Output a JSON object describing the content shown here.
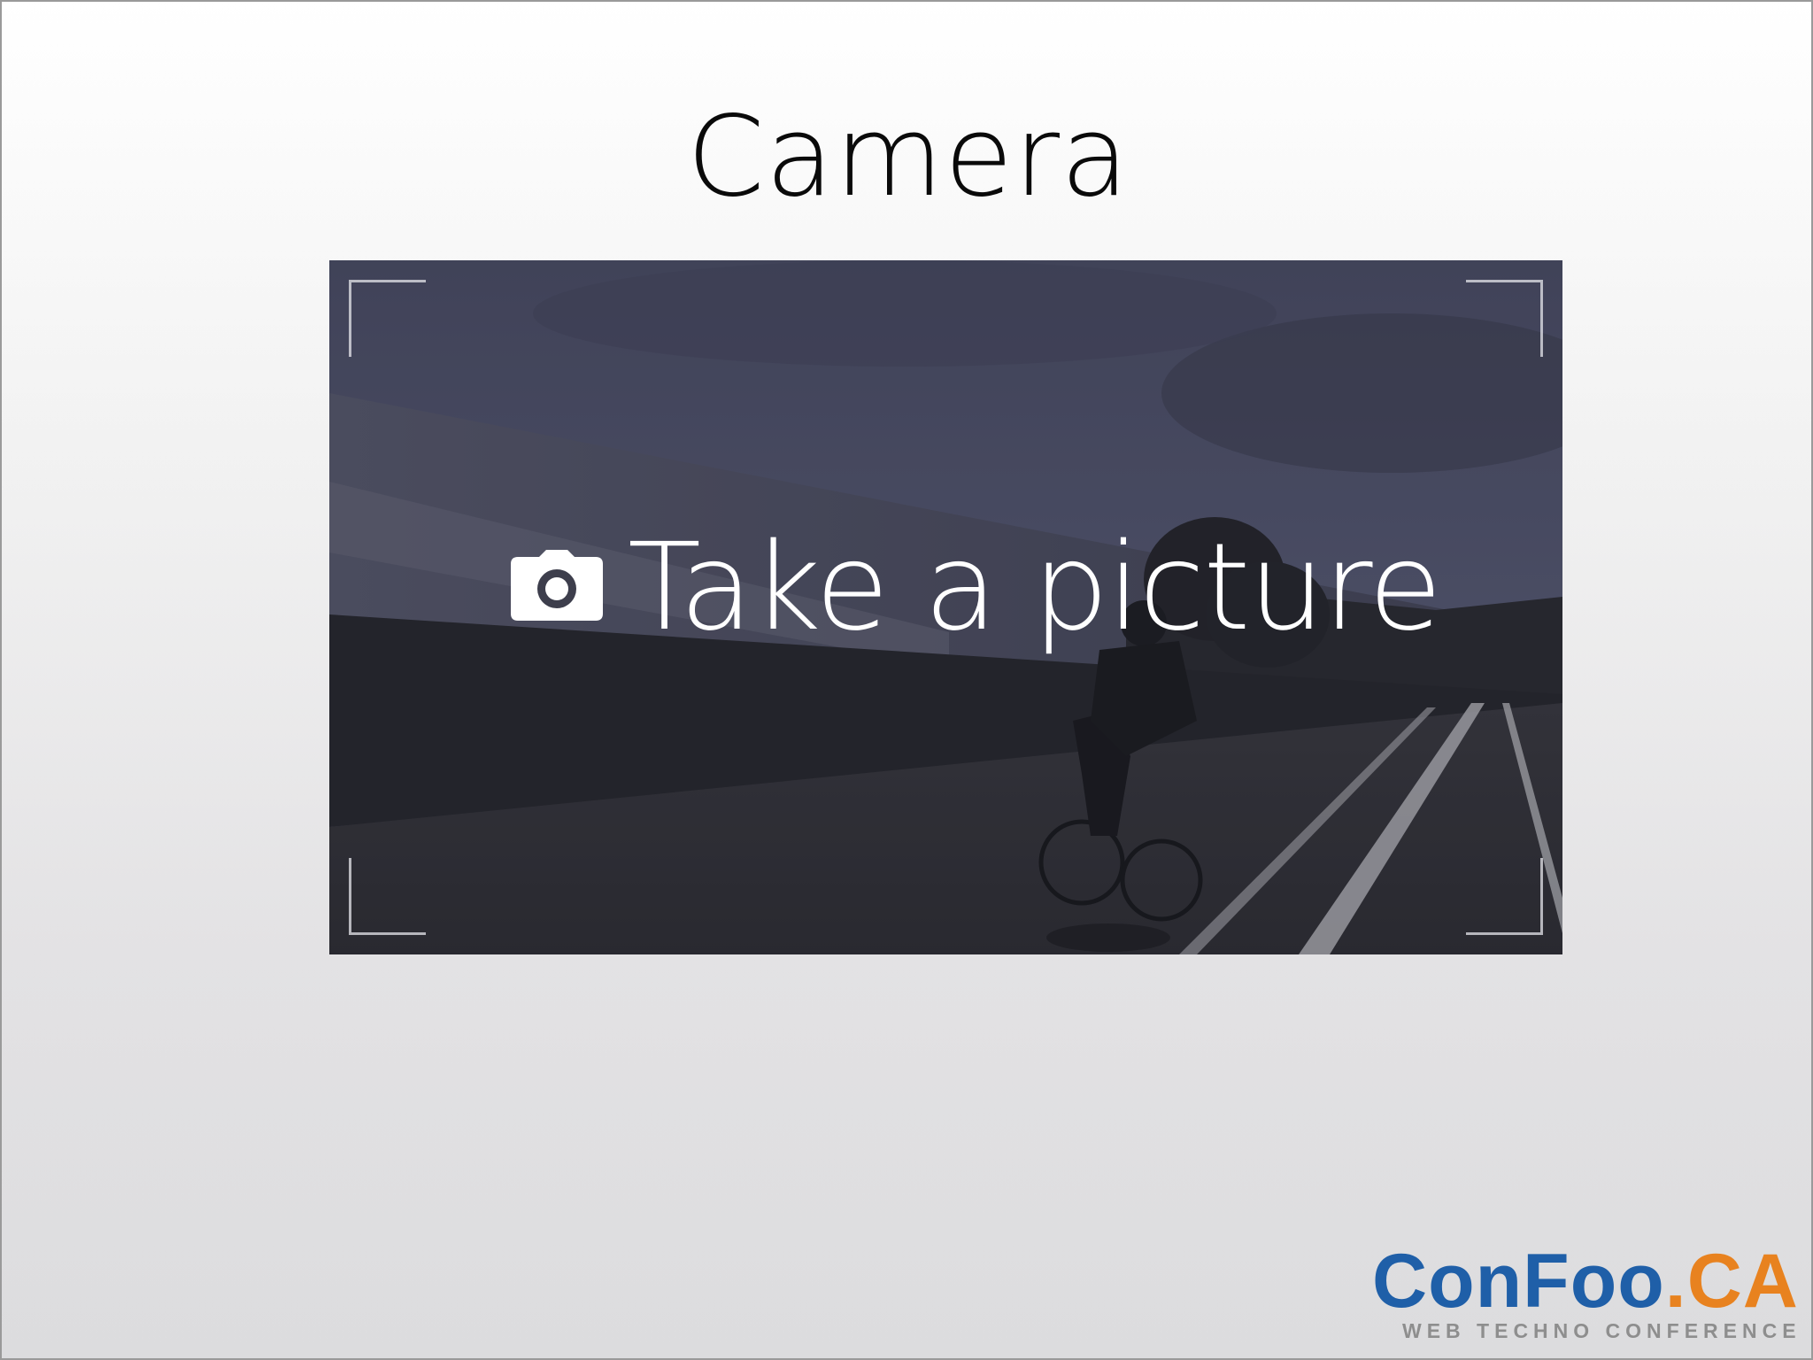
{
  "slide": {
    "title": "Camera"
  },
  "glass_card": {
    "label": "Take a picture",
    "icon": "camera-icon"
  },
  "logo": {
    "main": "ConFoo",
    "dot": ".",
    "tld": "CA",
    "tagline": "WEB TECHNO CONFERENCE"
  },
  "colors": {
    "logo_blue": "#1f5fa8",
    "logo_orange": "#e8821f",
    "card_overlay": "#3b3c4a"
  }
}
